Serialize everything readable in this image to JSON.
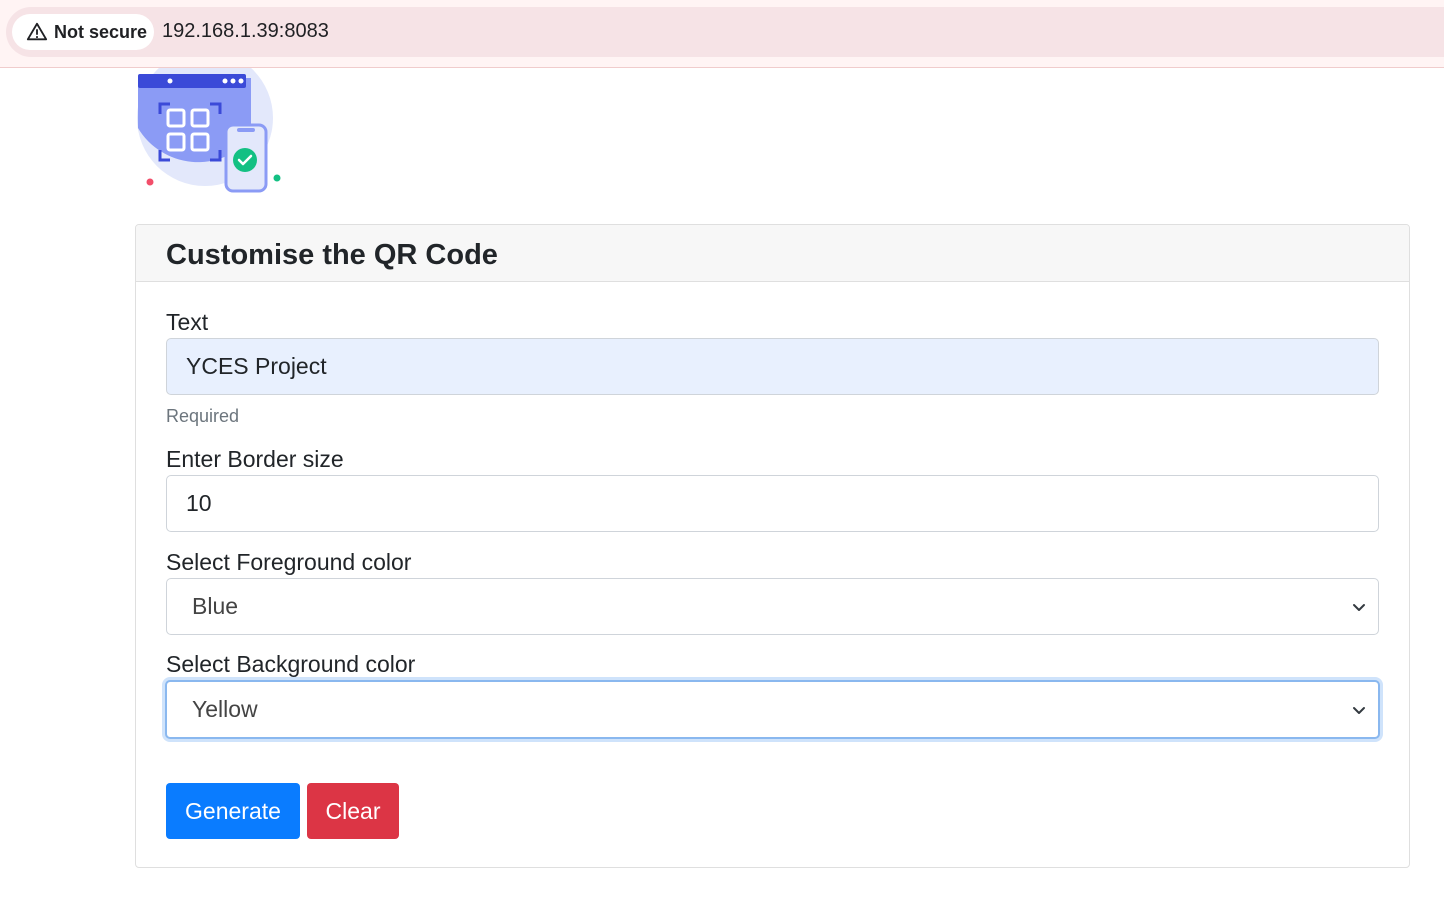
{
  "browser": {
    "security_label": "Not secure",
    "url": "192.168.1.39:8083"
  },
  "logo": {
    "icon": "qr-scan-phone-illustration"
  },
  "card": {
    "title": "Customise the QR Code",
    "text_field": {
      "label": "Text",
      "value": "YCES Project",
      "help": "Required"
    },
    "border_field": {
      "label": "Enter Border size",
      "value": "10"
    },
    "foreground_field": {
      "label": "Select Foreground color",
      "value": "Blue"
    },
    "background_field": {
      "label": "Select Background color",
      "value": "Yellow"
    },
    "buttons": {
      "generate": "Generate",
      "clear": "Clear"
    }
  },
  "colors": {
    "primary": "#0a7cff",
    "danger": "#dc3545",
    "autofill": "#e8f0fe"
  }
}
